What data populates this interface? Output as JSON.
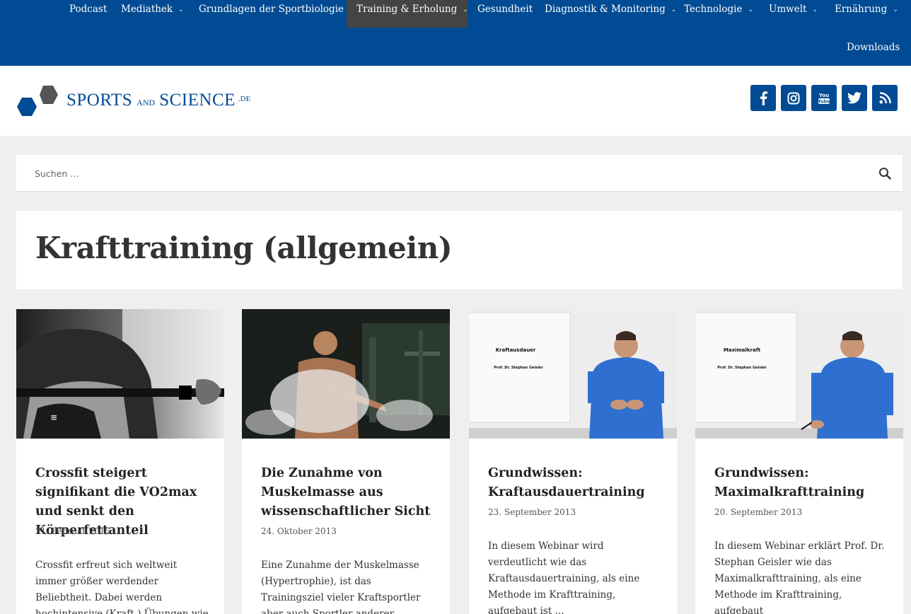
{
  "nav": {
    "items": [
      {
        "label": "Podcast",
        "dropdown": false
      },
      {
        "label": "Mediathek",
        "dropdown": true
      },
      {
        "label": "Grundlagen der Sportbiologie",
        "dropdown": true
      },
      {
        "label": "Training & Erholung",
        "dropdown": true,
        "active": true
      },
      {
        "label": "Gesundheit",
        "dropdown": false
      },
      {
        "label": "Diagnostik & Monitoring",
        "dropdown": true
      },
      {
        "label": "Technologie",
        "dropdown": true
      },
      {
        "label": "Umwelt",
        "dropdown": true
      },
      {
        "label": "Ernährung",
        "dropdown": true
      },
      {
        "label": "Downloads",
        "dropdown": false
      }
    ],
    "chevron": "⌄"
  },
  "logo": {
    "word1": "SPORTS",
    "word2": "AND",
    "word3": "SCIENCE",
    "word4": ".DE"
  },
  "social": [
    {
      "icon": "facebook-icon",
      "glyph": "f"
    },
    {
      "icon": "instagram-icon",
      "glyph": ""
    },
    {
      "icon": "youtube-icon",
      "glyph": "You Tube"
    },
    {
      "icon": "twitter-icon",
      "glyph": ""
    },
    {
      "icon": "rss-icon",
      "glyph": ""
    }
  ],
  "search": {
    "placeholder": "Suchen …"
  },
  "page": {
    "title": "Krafttraining (allgemein)"
  },
  "posts": [
    {
      "title": "Crossfit steigert signifikant die VO2max und senkt den Körperfettanteil",
      "date": "21. Februar 2015",
      "excerpt": "Crossfit erfreut sich weltweit immer größer werdender Beliebtheit. Dabei werden hochintensive (Kraft-) Übungen wie Squats, Deadlifts"
    },
    {
      "title": "Die Zunahme von Muskelmasse aus wissenschaftlicher Sicht",
      "date": "24. Oktober 2013",
      "excerpt": "Eine Zunahme der Muskelmasse (Hypertrophie), ist das Trainingsziel vieler Kraftsportler aber auch Sportler anderer Disziplinen"
    },
    {
      "title": "Grundwissen: Kraftausdauertraining",
      "date": "23. September 2013",
      "excerpt": "In diesem Webinar wird verdeutlicht wie das Kraftausdauertraining, als eine Methode im Krafttraining, aufgebaut ist …",
      "slide_title": "Kraftausdauer",
      "slide_author": "Prof. Dr. Stephan Geisler"
    },
    {
      "title": "Grundwissen: Maximalkrafttraining",
      "date": "20. September 2013",
      "excerpt": "In diesem Webinar erklärt Prof. Dr. Stephan Geisler wie das Maximalkrafttraining, als eine Methode im Krafttraining, aufgebaut",
      "slide_title": "Maximalkraft",
      "slide_author": "Prof. Dr. Stephan Geisler"
    }
  ],
  "colors": {
    "brand": "#004b93",
    "active_nav": "#444444",
    "page_bg": "#efefef"
  }
}
